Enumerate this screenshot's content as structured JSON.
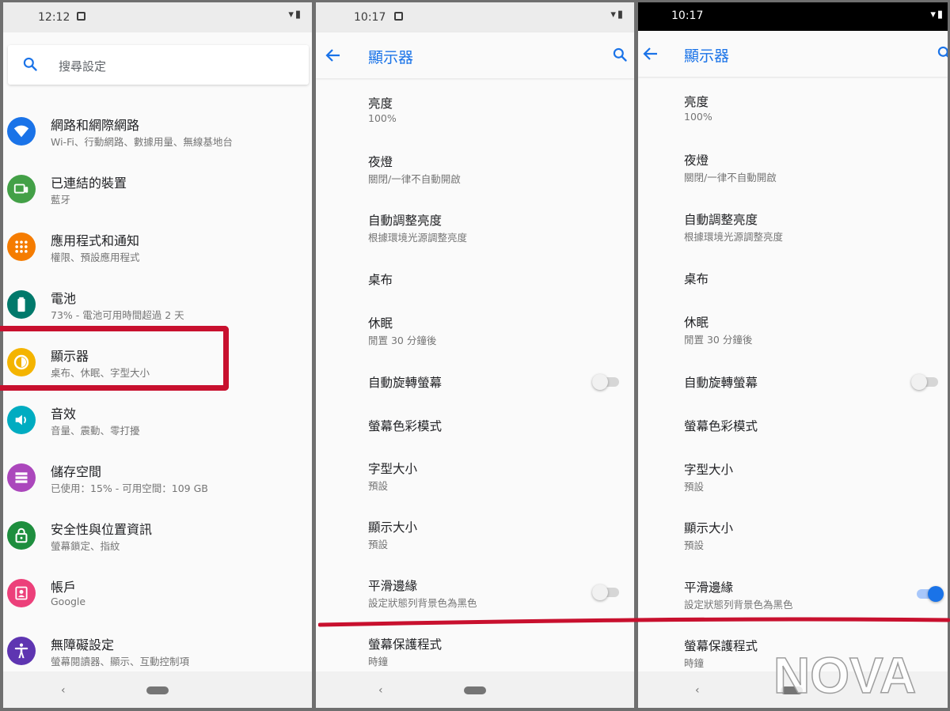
{
  "colors": {
    "accent": "#1a73e8",
    "highlight": "#c8102e"
  },
  "screen1": {
    "time": "12:12",
    "search_placeholder": "搜尋設定",
    "categories": [
      {
        "title": "網路和網際網路",
        "subtitle": "Wi-Fi、行動網路、數據用量、無線基地台",
        "icon": "wifi-icon",
        "color": "#1a73e8"
      },
      {
        "title": "已連結的裝置",
        "subtitle": "藍牙",
        "icon": "devices-icon",
        "color": "#43a047"
      },
      {
        "title": "應用程式和通知",
        "subtitle": "權限、預設應用程式",
        "icon": "apps-icon",
        "color": "#f57c00"
      },
      {
        "title": "電池",
        "subtitle": "73% - 電池可用時間超過 2 天",
        "icon": "battery-icon",
        "color": "#00796b"
      },
      {
        "title": "顯示器",
        "subtitle": "桌布、休眠、字型大小",
        "icon": "brightness-icon",
        "color": "#f4b400"
      },
      {
        "title": "音效",
        "subtitle": "音量、震動、零打擾",
        "icon": "volume-icon",
        "color": "#00acc1"
      },
      {
        "title": "儲存空間",
        "subtitle": "已使用：15% - 可用空間：109 GB",
        "icon": "storage-icon",
        "color": "#ab47bc"
      },
      {
        "title": "安全性與位置資訊",
        "subtitle": "螢幕鎖定、指紋",
        "icon": "lock-icon",
        "color": "#1e8e3e"
      },
      {
        "title": "帳戶",
        "subtitle": "Google",
        "icon": "account-icon",
        "color": "#ec407a"
      },
      {
        "title": "無障礙設定",
        "subtitle": "螢幕閱讀器、顯示、互動控制項",
        "icon": "accessibility-icon",
        "color": "#5e35b1"
      }
    ]
  },
  "screen2": {
    "time": "10:17",
    "title": "顯示器"
  },
  "screen3": {
    "time": "10:17",
    "title": "顯示器"
  },
  "display_items": [
    {
      "title": "亮度",
      "subtitle": "100%"
    },
    {
      "title": "夜燈",
      "subtitle": "關閉/一律不自動開啟"
    },
    {
      "title": "自動調整亮度",
      "subtitle": "根據環境光源調整亮度"
    },
    {
      "title": "桌布"
    },
    {
      "title": "休眠",
      "subtitle": "閒置 30 分鐘後"
    },
    {
      "title": "自動旋轉螢幕",
      "toggle": true
    },
    {
      "title": "螢幕色彩模式"
    },
    {
      "title": "字型大小",
      "subtitle": "預設"
    },
    {
      "title": "顯示大小",
      "subtitle": "預設"
    },
    {
      "title": "平滑邊緣",
      "subtitle": "設定狀態列背景色為黑色",
      "toggle": true
    },
    {
      "title": "螢幕保護程式",
      "subtitle": "時鐘"
    }
  ],
  "toggle_states": {
    "screen2": {
      "auto_rotate": false,
      "smooth_edges": false
    },
    "screen3": {
      "auto_rotate": false,
      "smooth_edges": true
    }
  },
  "watermark": {
    "text": "NOVA"
  }
}
